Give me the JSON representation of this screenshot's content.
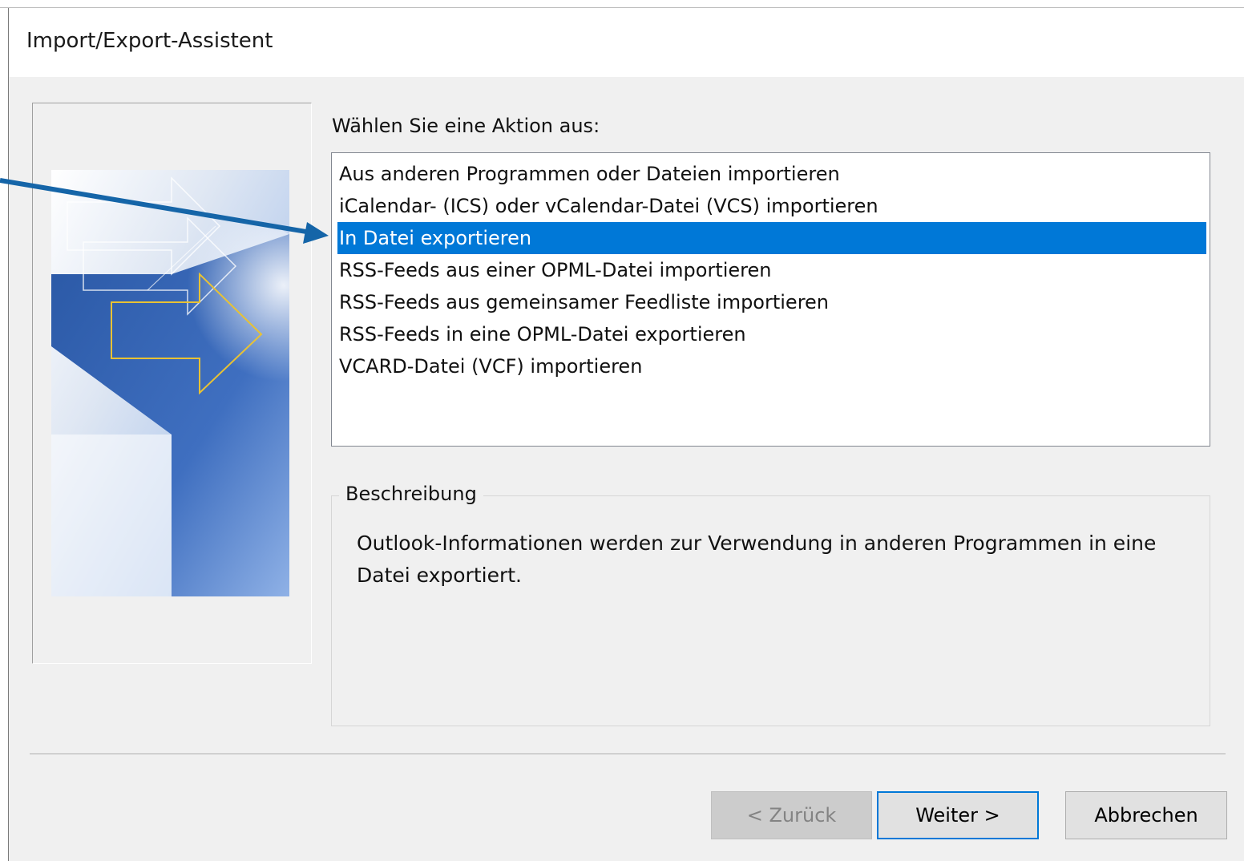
{
  "window": {
    "title": "Import/Export-Assistent"
  },
  "prompt_label": "Wählen Sie eine Aktion aus:",
  "actions": [
    {
      "label": "Aus anderen Programmen oder Dateien importieren",
      "selected": false
    },
    {
      "label": "iCalendar- (ICS) oder vCalendar-Datei (VCS) importieren",
      "selected": false
    },
    {
      "label": "In Datei exportieren",
      "selected": true
    },
    {
      "label": "RSS-Feeds aus einer OPML-Datei importieren",
      "selected": false
    },
    {
      "label": "RSS-Feeds aus gemeinsamer Feedliste importieren",
      "selected": false
    },
    {
      "label": "RSS-Feeds in eine OPML-Datei exportieren",
      "selected": false
    },
    {
      "label": "VCARD-Datei (VCF) importieren",
      "selected": false
    }
  ],
  "description": {
    "legend": "Beschreibung",
    "text": "Outlook-Informationen werden zur Verwendung in anderen Programmen in eine Datei exportiert."
  },
  "buttons": {
    "back": "< Zurück",
    "next": "Weiter >",
    "cancel": "Abbrechen"
  },
  "colors": {
    "selection": "#0078d7",
    "callout_arrow": "#1565a8",
    "art_yellow": "#e8c234"
  },
  "icons": {
    "wizard_art": "wizard-arrows-graphic",
    "callout": "callout-arrow"
  }
}
